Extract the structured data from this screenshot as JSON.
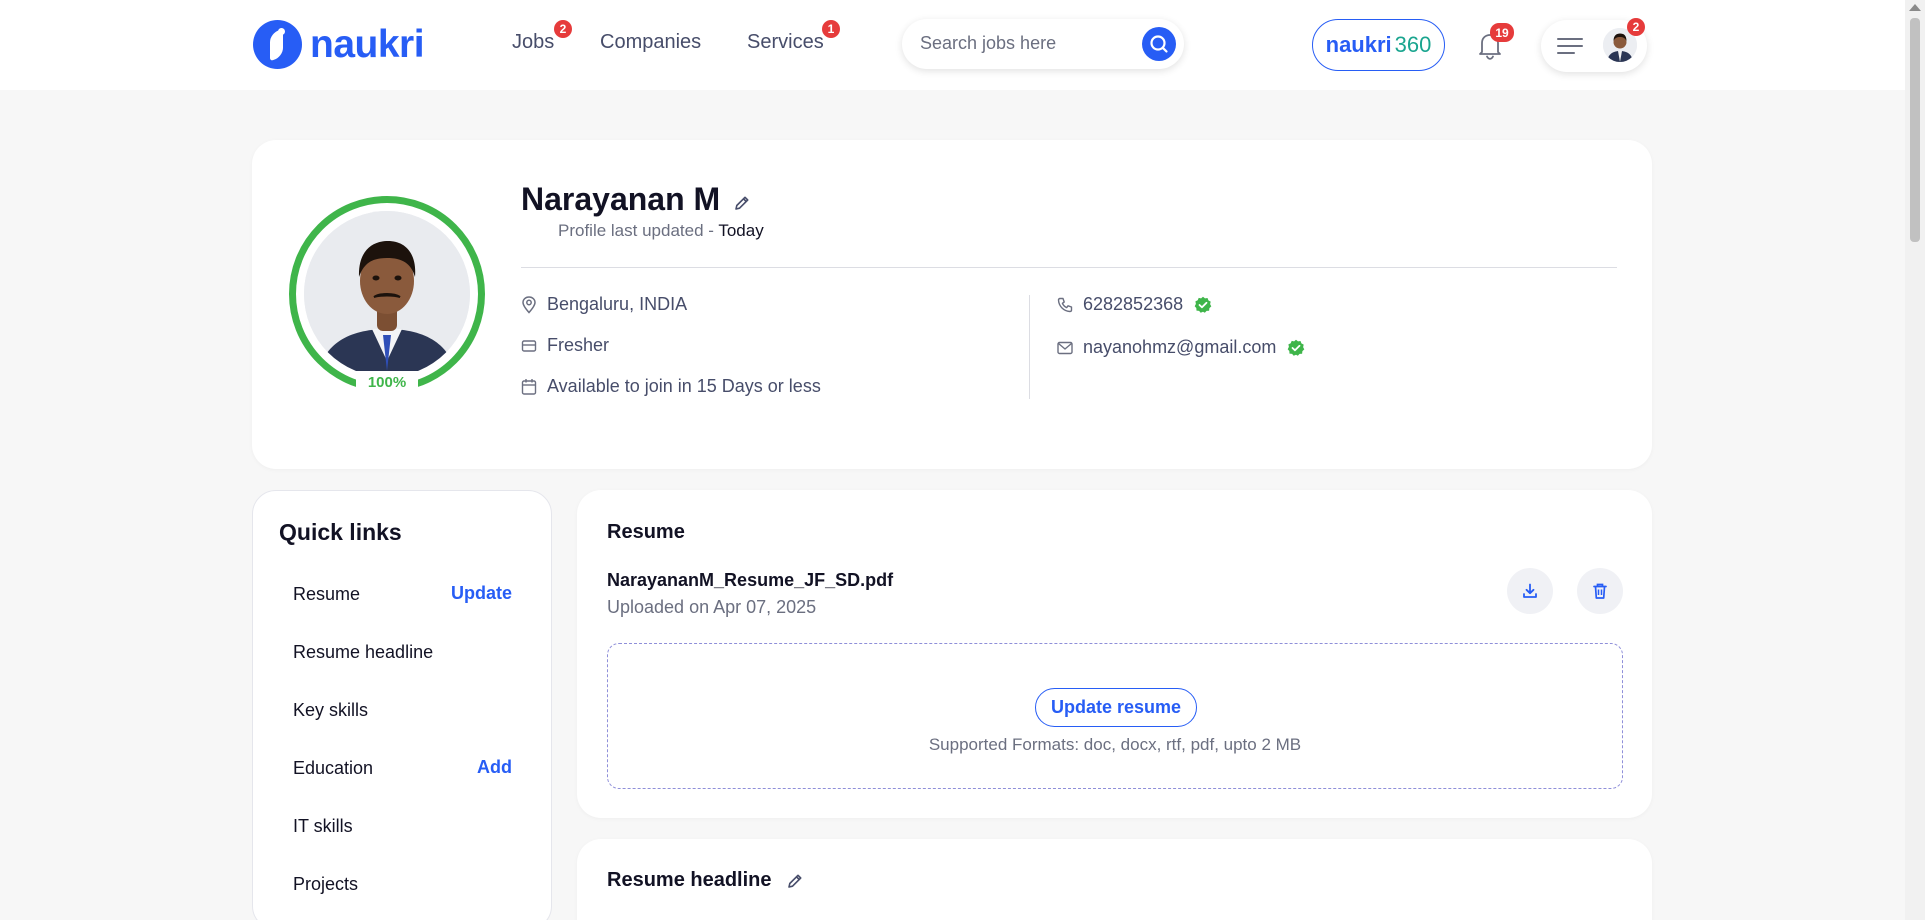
{
  "header": {
    "logo_text": "naukri",
    "nav": [
      {
        "label": "Jobs",
        "badge": "2"
      },
      {
        "label": "Companies",
        "badge": ""
      },
      {
        "label": "Services",
        "badge": "1"
      }
    ],
    "search_placeholder": "Search jobs here",
    "naukri360_a": "naukri",
    "naukri360_b": "360",
    "notifications_badge": "19",
    "menu_badge": "2"
  },
  "profile": {
    "name": "Narayanan M",
    "updated_prefix": "Profile last updated - ",
    "updated_value": "Today",
    "completion": "100%",
    "location": "Bengaluru, INDIA",
    "experience": "Fresher",
    "availability": "Available to join in 15 Days or less",
    "phone": "6282852368",
    "email": "nayanohmz@gmail.com"
  },
  "quick_links": {
    "title": "Quick links",
    "items": [
      {
        "label": "Resume",
        "action": "Update"
      },
      {
        "label": "Resume headline",
        "action": ""
      },
      {
        "label": "Key skills",
        "action": ""
      },
      {
        "label": "Education",
        "action": "Add"
      },
      {
        "label": "IT skills",
        "action": ""
      },
      {
        "label": "Projects",
        "action": ""
      }
    ]
  },
  "resume": {
    "title": "Resume",
    "file_name": "NarayananM_Resume_JF_SD.pdf",
    "uploaded": "Uploaded on Apr 07, 2025",
    "update_button": "Update resume",
    "formats": "Supported Formats: doc, docx, rtf, pdf, upto 2 MB"
  },
  "resume_headline": {
    "title": "Resume headline"
  },
  "colors": {
    "brand": "#275df5",
    "success": "#3fb54a",
    "badge": "#e63b3b"
  }
}
